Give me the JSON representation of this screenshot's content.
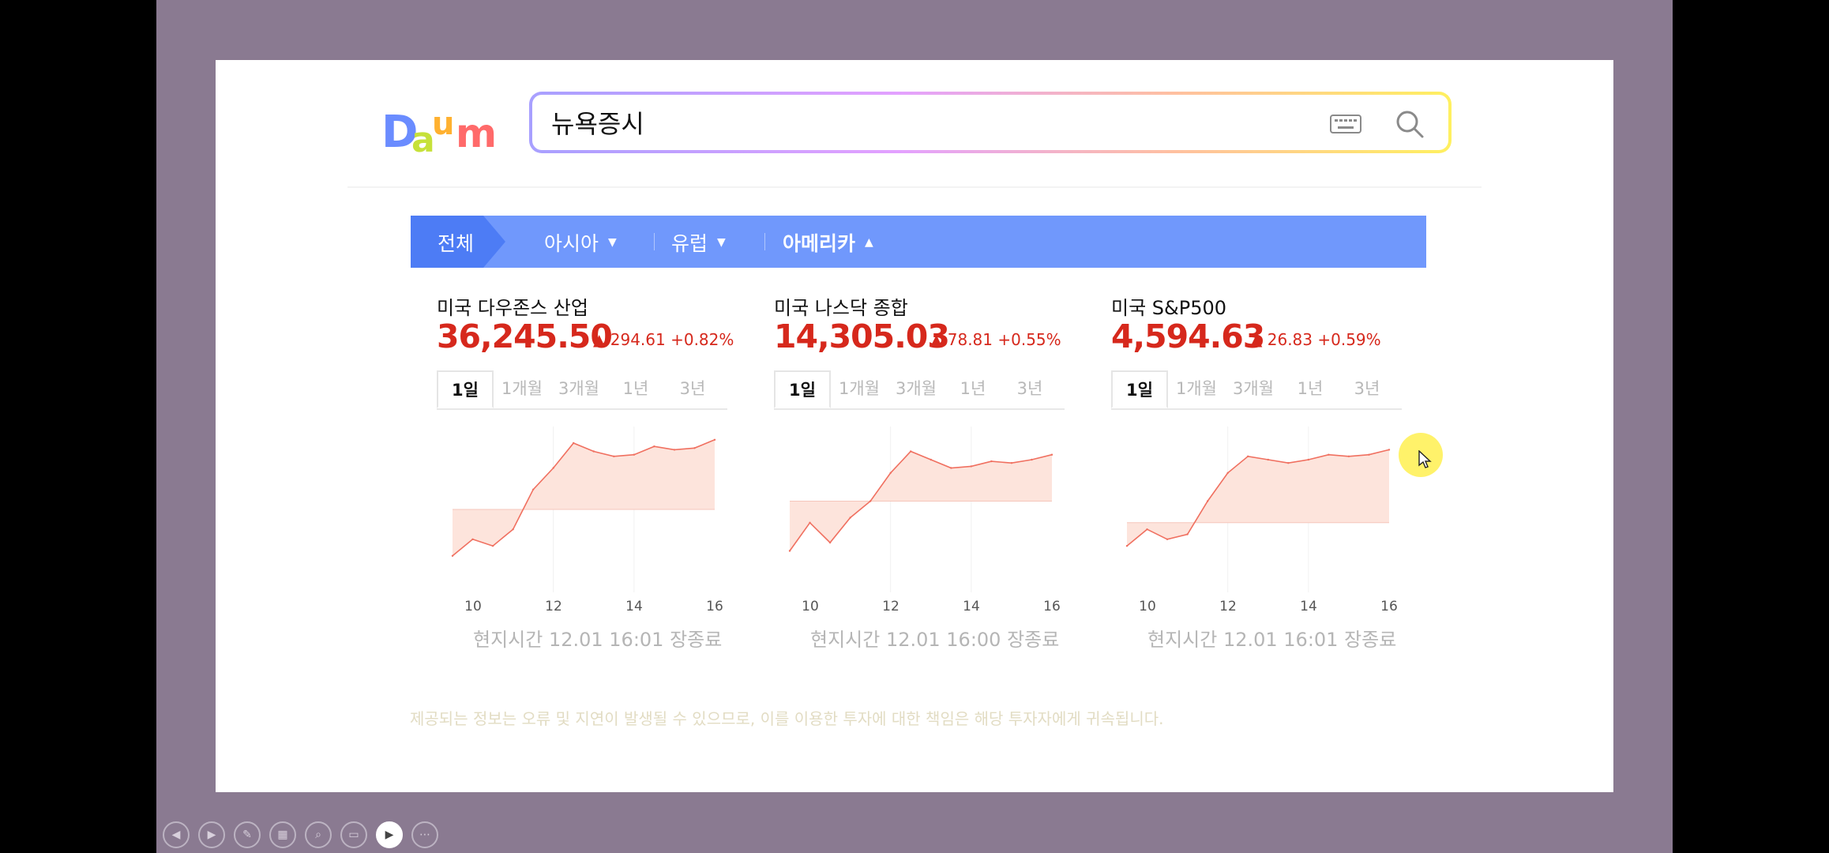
{
  "search": {
    "logo_text": "Daum",
    "query": "뉴욕증시"
  },
  "nav": {
    "tabs": [
      {
        "label": "전체"
      },
      {
        "label": "아시아"
      },
      {
        "label": "유럽"
      },
      {
        "label": "아메리카"
      }
    ]
  },
  "periods": [
    "1일",
    "1개월",
    "3개월",
    "1년",
    "3년"
  ],
  "panels": [
    {
      "title": "미국 다우존스 산업",
      "value": "36,245.50",
      "change": "294.61 +0.82%",
      "status": "현지시간 12.01 16:01 장종료"
    },
    {
      "title": "미국 나스닥 종합",
      "value": "14,305.03",
      "change": "78.81 +0.55%",
      "status": "현지시간 12.01 16:00 장종료"
    },
    {
      "title": "미국 S&P500",
      "value": "4,594.63",
      "change": "26.83 +0.59%",
      "status": "현지시간 12.01 16:01 장종료"
    }
  ],
  "x_ticks": [
    "10",
    "12",
    "14",
    "16"
  ],
  "disclaimer": "제공되는 정보는 오류 및 지연이 발생될 수 있으므로, 이를 이용한 투자에 대한 책임은 해당 투자자에게 귀속됩니다.",
  "colors": {
    "up": "#d6281c",
    "nav_bg": "#7098fc",
    "nav_active": "#4d7cf5",
    "up_fill": "#fde4dc",
    "down_fill": "#e4f7fb",
    "slide_bg": "#8a7a91"
  },
  "chart_data": [
    {
      "type": "line",
      "title": "미국 다우존스 산업",
      "x": [
        9.5,
        10,
        10.5,
        11,
        11.5,
        12,
        12.5,
        13,
        13.5,
        14,
        14.5,
        15,
        15.5,
        16
      ],
      "values": [
        0.22,
        0.32,
        0.28,
        0.38,
        0.62,
        0.75,
        0.9,
        0.85,
        0.82,
        0.83,
        0.88,
        0.86,
        0.87,
        0.92
      ],
      "baseline": 0.5,
      "x_ticks": [
        10,
        12,
        14,
        16
      ]
    },
    {
      "type": "line",
      "title": "미국 나스닥 종합",
      "x": [
        9.5,
        10,
        10.5,
        11,
        11.5,
        12,
        12.5,
        13,
        13.5,
        14,
        14.5,
        15,
        15.5,
        16
      ],
      "values": [
        0.25,
        0.42,
        0.3,
        0.45,
        0.55,
        0.72,
        0.85,
        0.8,
        0.75,
        0.76,
        0.79,
        0.78,
        0.8,
        0.83
      ],
      "baseline": 0.55,
      "x_ticks": [
        10,
        12,
        14,
        16
      ]
    },
    {
      "type": "line",
      "title": "미국 S&P500",
      "x": [
        9.5,
        10,
        10.5,
        11,
        11.5,
        12,
        12.5,
        13,
        13.5,
        14,
        14.5,
        15,
        15.5,
        16
      ],
      "values": [
        0.28,
        0.38,
        0.32,
        0.35,
        0.55,
        0.72,
        0.82,
        0.8,
        0.78,
        0.8,
        0.83,
        0.82,
        0.83,
        0.86
      ],
      "baseline": 0.42,
      "x_ticks": [
        10,
        12,
        14,
        16
      ]
    }
  ],
  "toolbar": [
    "prev-icon",
    "next-icon",
    "pen-icon",
    "slides-icon",
    "zoom-icon",
    "subtitles-icon",
    "camera-icon",
    "more-icon"
  ]
}
